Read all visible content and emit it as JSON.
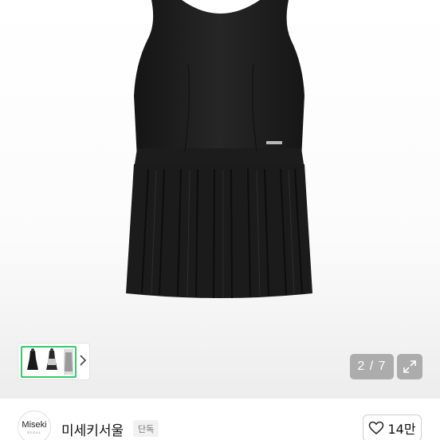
{
  "gallery": {
    "counter": "2 / 7",
    "thumb_next_icon": "chevron-right-icon",
    "expand_icon": "expand-icon"
  },
  "shop": {
    "logo_text": "Miseki",
    "logo_subtext": "SEOUL",
    "name": "미세키서울",
    "badge": "단독",
    "like_icon": "heart-outline-icon",
    "like_count": "14만"
  },
  "colors": {
    "dress": "#1a1a1a",
    "thumb_border": "#33cc66",
    "overlay_button": "#969696"
  }
}
